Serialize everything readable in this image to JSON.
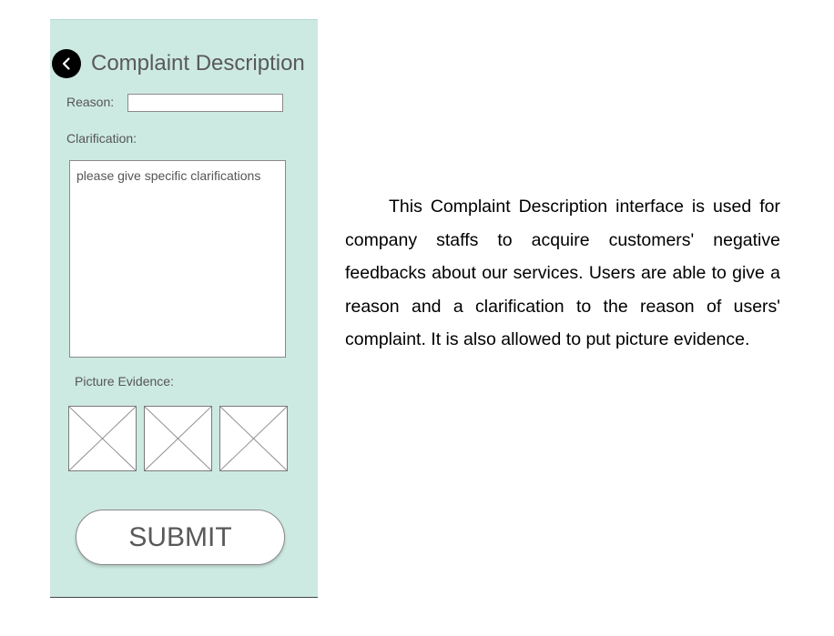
{
  "screen": {
    "title": "Complaint Description",
    "back_icon": "chevron-left-icon",
    "reason_label": "Reason:",
    "reason_value": "",
    "clarification_label": "Clarification:",
    "clarification_placeholder": "please give specific clarifications",
    "picture_label": "Picture Evidence:",
    "picture_slots": [
      "image-placeholder-icon",
      "image-placeholder-icon",
      "image-placeholder-icon"
    ],
    "submit_label": "SUBMIT"
  },
  "description": "This Complaint Description interface is used for company staffs to acquire customers' negative feedbacks about our services. Users are able to give a reason and a clarification to the reason of users' complaint. It is also allowed to put picture evidence.",
  "colors": {
    "screen_background": "#cdeae2",
    "title_text": "#595959",
    "back_button": "#000000"
  }
}
